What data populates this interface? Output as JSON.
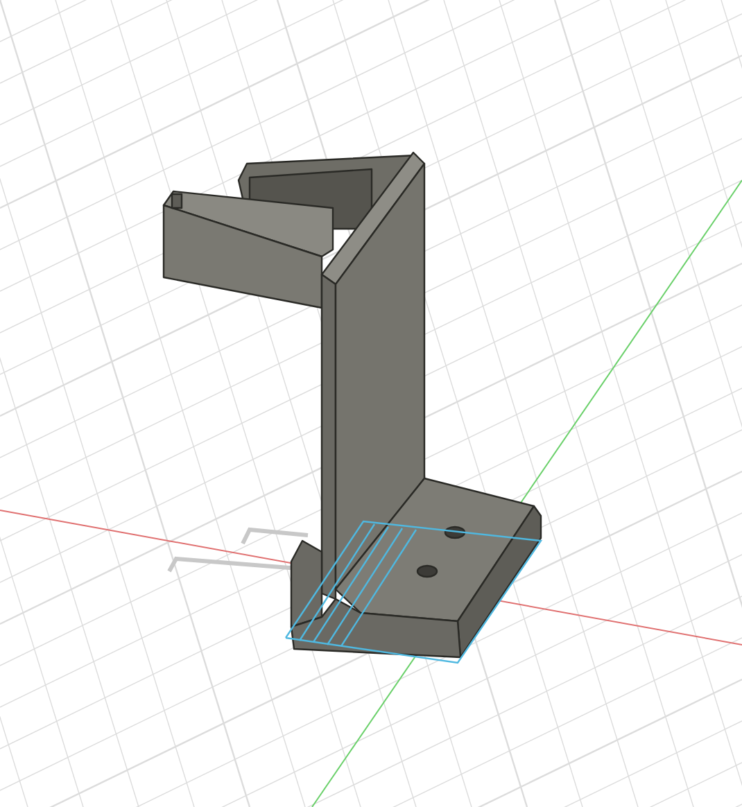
{
  "viewport": {
    "kind": "cad-3d"
  }
}
